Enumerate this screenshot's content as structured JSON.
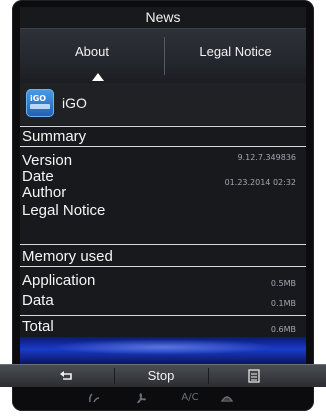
{
  "header": {
    "title": "News"
  },
  "tabs": [
    {
      "label": "About",
      "active": true
    },
    {
      "label": "Legal Notice",
      "active": false
    }
  ],
  "app": {
    "name": "iGO",
    "icon": "igo-app-icon",
    "icon_text": "iGO"
  },
  "summary": {
    "heading": "Summary",
    "rows": [
      {
        "label": "Version",
        "value": "9.12.7.349836"
      },
      {
        "label": "Date",
        "value": "01.23.2014  02:32"
      },
      {
        "label": "Author",
        "value": ""
      },
      {
        "label": "Legal Notice",
        "value": ""
      }
    ]
  },
  "memory": {
    "heading": "Memory used",
    "rows": [
      {
        "label": "Application",
        "value": "0.5MB"
      },
      {
        "label": "Data",
        "value": "0.1MB"
      }
    ],
    "total": {
      "label": "Total",
      "value": "0.6MB"
    }
  },
  "buttons": {
    "back_icon": "return-arrow-icon",
    "stop_label": "Stop",
    "menu_icon": "menu-list-icon"
  },
  "controls": {
    "ac_label": "A/C",
    "icons": [
      "seat-heat-icon",
      "fan-icon",
      "ac-label",
      "defrost-icon"
    ]
  },
  "colors": {
    "screen_bg": "#18191c",
    "accent_blue": "#1a3ac8",
    "button_bar": "#3a3d42"
  }
}
